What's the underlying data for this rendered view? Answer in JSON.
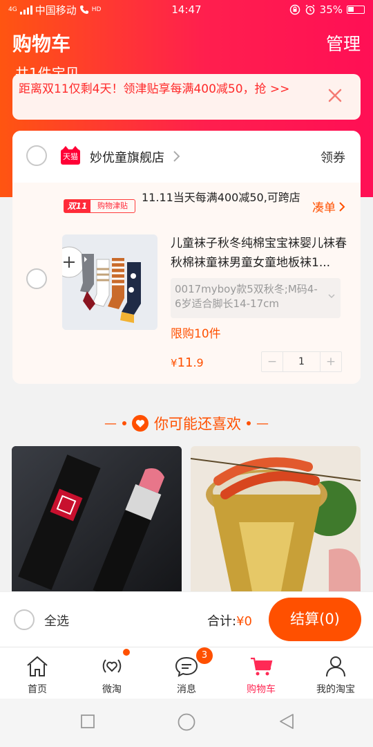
{
  "status_bar": {
    "network": "4G",
    "carrier": "中国移动",
    "hd": "HD",
    "time": "14:47",
    "battery": "35%"
  },
  "header": {
    "title": "购物车",
    "manage_label": "管理",
    "count_peek": "共1件宝贝"
  },
  "promo": {
    "text": "距离双11仅剩4天！领津贴享每满400减50，抢 >>",
    "accent_color": "#ff2a2a"
  },
  "store": {
    "badge": "天猫",
    "name": "妙优童旗舰店",
    "coupon_label": "领券",
    "discount": {
      "tag_left": "双11",
      "tag_right": "购物津贴",
      "text": "11.11当天每满400减50,可跨店",
      "action_label": "凑单"
    },
    "item": {
      "title": "儿童袜子秋冬纯棉宝宝袜婴儿袜春秋棉袜童袜男童女童地板袜1...",
      "sku": "0017myboy款5双秋冬;M码4-6岁适合脚长14-17cm",
      "limit": "限购10件",
      "price_currency": "¥",
      "price_int": "11",
      "price_dec": ".9",
      "quantity": "1",
      "minus": "−",
      "plus": "+"
    }
  },
  "recommend": {
    "title": "你可能还喜欢",
    "left_line": "—",
    "right_line": "—"
  },
  "checkout": {
    "select_all_label": "全选",
    "total_label": "合计:",
    "total_value": "¥0",
    "button_label": "结算(0)",
    "accent_color": "#ff5000"
  },
  "tabs": [
    {
      "label": "首页",
      "icon": "home-icon"
    },
    {
      "label": "微淘",
      "icon": "weitao-icon"
    },
    {
      "label": "消息",
      "icon": "message-icon",
      "badge": "3"
    },
    {
      "label": "购物车",
      "icon": "cart-icon",
      "active": true
    },
    {
      "label": "我的淘宝",
      "icon": "user-icon"
    }
  ],
  "brand_colors": {
    "header_gradient_start": "#ff5511",
    "header_gradient_end": "#ff0f55",
    "active_tab": "#ff2a55"
  }
}
